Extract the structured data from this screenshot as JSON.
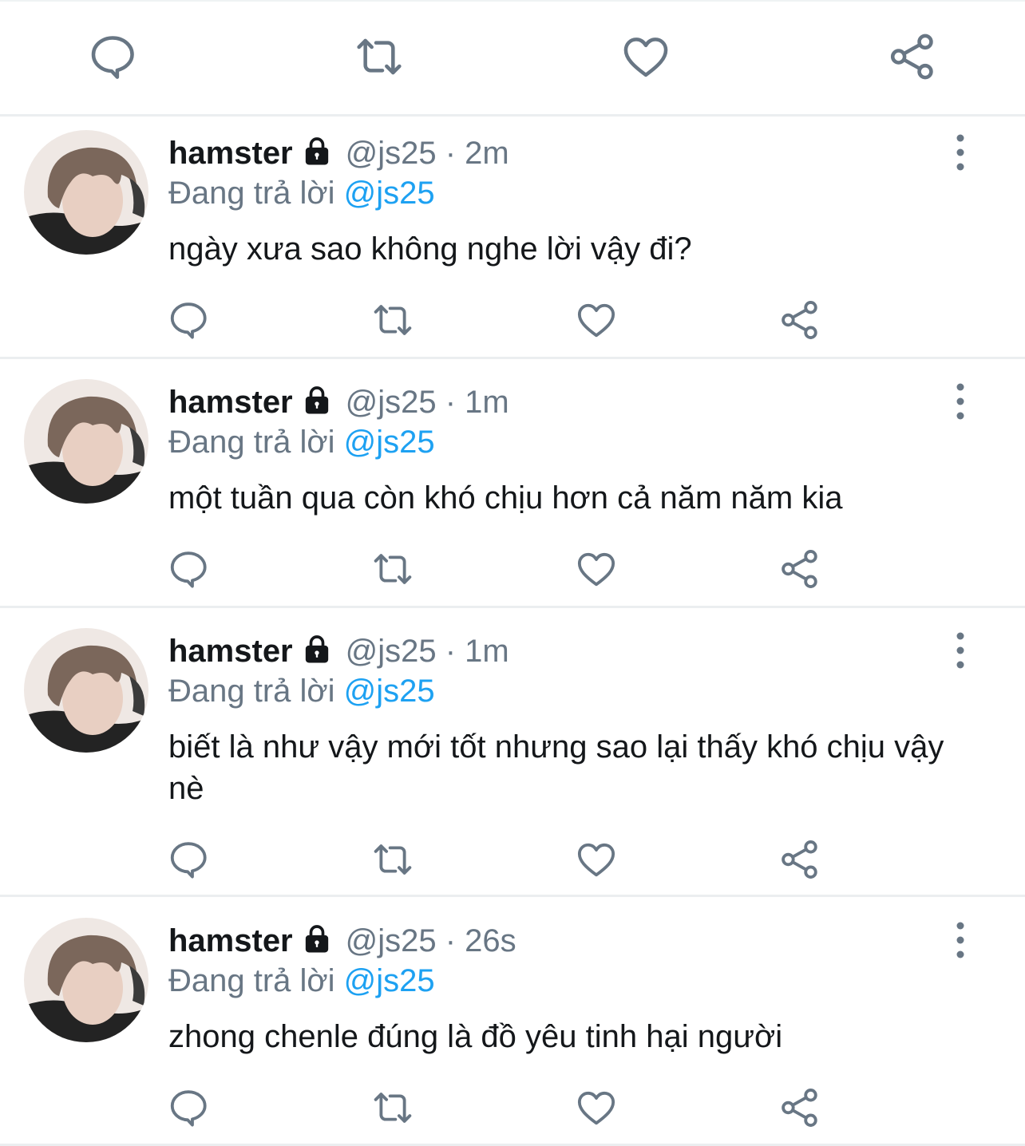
{
  "top_actions": {
    "icons": [
      "reply-icon",
      "retweet-icon",
      "like-icon",
      "share-icon"
    ]
  },
  "tweets": [
    {
      "name": "hamster",
      "handle": "@js25",
      "time": "2m",
      "reply_label": "Đang trả lời",
      "reply_to": "@js25",
      "text": "ngày xưa sao không nghe lời vậy đi?"
    },
    {
      "name": "hamster",
      "handle": "@js25",
      "time": "1m",
      "reply_label": "Đang trả lời",
      "reply_to": "@js25",
      "text": "một tuần qua còn khó chịu hơn cả năm năm kia"
    },
    {
      "name": "hamster",
      "handle": "@js25",
      "time": "1m",
      "reply_label": "Đang trả lời",
      "reply_to": "@js25",
      "text": "biết là như vậy mới tốt nhưng sao lại thấy khó chịu vậy nè"
    },
    {
      "name": "hamster",
      "handle": "@js25",
      "time": "26s",
      "reply_label": "Đang trả lời",
      "reply_to": "@js25",
      "text": "zhong chenle đúng là đồ yêu tinh hại người"
    }
  ],
  "colors": {
    "text": "#14171a",
    "secondary": "#687684",
    "mention": "#1da1f2",
    "divider": "#ebeef0"
  }
}
